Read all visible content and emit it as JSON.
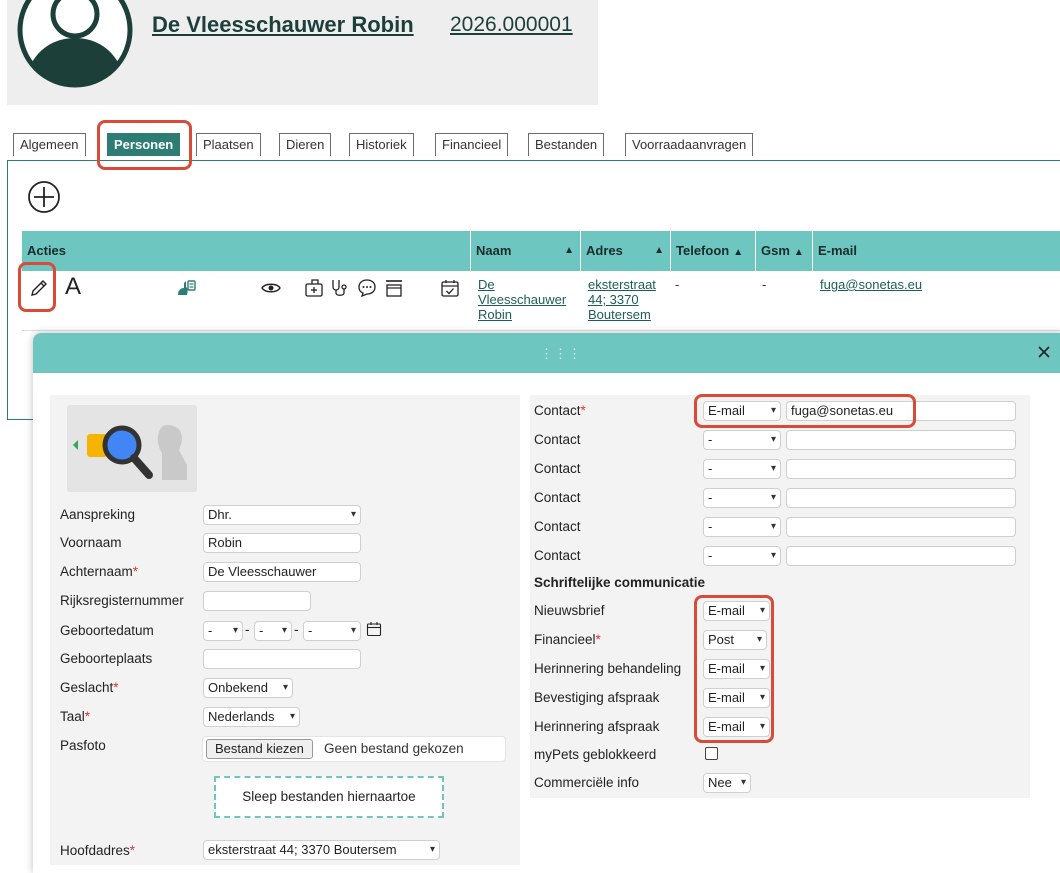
{
  "header": {
    "person_name": "De Vleesschauwer Robin",
    "record_number": "2026.000001"
  },
  "tabs": [
    {
      "label": "Algemeen"
    },
    {
      "label": "Personen",
      "active": true
    },
    {
      "label": "Plaatsen"
    },
    {
      "label": "Dieren"
    },
    {
      "label": "Historiek"
    },
    {
      "label": "Financieel"
    },
    {
      "label": "Bestanden"
    },
    {
      "label": "Voorraadaanvragen"
    }
  ],
  "table": {
    "columns": [
      "Acties",
      "Naam",
      "Adres",
      "Telefoon",
      "Gsm",
      "E-mail"
    ],
    "row": {
      "name": "De Vleesschauwer Robin",
      "name_lines": [
        "De",
        "Vleesschauwer",
        "Robin"
      ],
      "address_lines": [
        "eksterstraat",
        "44; 3370",
        "Boutersem"
      ],
      "phone": "-",
      "gsm": "-",
      "email": "fuga@sonetas.eu",
      "action_letter": "A"
    },
    "action_icons": [
      "edit-pencil-icon",
      "letter-a-icon",
      "pet-owner-icon",
      "view-eye-icon",
      "medical-kit-icon",
      "stethoscope-icon",
      "chat-bubble-icon",
      "scale-icon",
      "calendar-check-icon"
    ]
  },
  "form_left": {
    "fields": [
      {
        "label": "Aanspreking",
        "value": "Dhr.",
        "type": "select",
        "required": false
      },
      {
        "label": "Voornaam",
        "value": "Robin",
        "type": "text",
        "required": false
      },
      {
        "label": "Achternaam",
        "value": "De Vleesschauwer",
        "type": "text",
        "required": true
      },
      {
        "label": "Rijksregisternummer",
        "value": "",
        "type": "text",
        "required": false
      },
      {
        "label": "Geboortedatum",
        "value": "",
        "type": "date",
        "required": false
      },
      {
        "label": "Geboorteplaats",
        "value": "",
        "type": "text",
        "required": false
      },
      {
        "label": "Geslacht",
        "value": "Onbekend",
        "type": "select",
        "required": true
      },
      {
        "label": "Taal",
        "value": "Nederlands",
        "type": "select",
        "required": true
      },
      {
        "label": "Pasfoto",
        "value": "",
        "type": "file",
        "required": false
      },
      {
        "label": "Hoofdadres",
        "value": "eksterstraat 44; 3370 Boutersem",
        "type": "select",
        "required": true
      }
    ],
    "date_parts": [
      "-",
      "-",
      "-"
    ],
    "date_separator": "-",
    "file_button": "Bestand kiezen",
    "file_status": "Geen bestand gekozen",
    "dropzone": "Sleep bestanden hiernaartoe"
  },
  "form_right": {
    "contacts": [
      {
        "label": "Contact",
        "type": "E-mail",
        "value": "fuga@sonetas.eu",
        "required": true
      },
      {
        "label": "Contact",
        "type": "-",
        "value": "",
        "required": false
      },
      {
        "label": "Contact",
        "type": "-",
        "value": "",
        "required": false
      },
      {
        "label": "Contact",
        "type": "-",
        "value": "",
        "required": false
      },
      {
        "label": "Contact",
        "type": "-",
        "value": "",
        "required": false
      },
      {
        "label": "Contact",
        "type": "-",
        "value": "",
        "required": false
      }
    ],
    "section_title": "Schriftelijke communicatie",
    "communication": [
      {
        "label": "Nieuwsbrief",
        "value": "E-mail",
        "required": false
      },
      {
        "label": "Financieel",
        "value": "Post",
        "required": true
      },
      {
        "label": "Herinnering behandeling",
        "value": "E-mail",
        "required": false
      },
      {
        "label": "Bevestiging afspraak",
        "value": "E-mail",
        "required": false
      },
      {
        "label": "Herinnering afspraak",
        "value": "E-mail",
        "required": false
      }
    ],
    "mypets_label": "myPets geblokkeerd",
    "mypets_checked": false,
    "commercial_label": "Commerciële info",
    "commercial_value": "Nee"
  },
  "colors": {
    "accent": "#2e7d74",
    "header_teal": "#6ec6c1",
    "highlight": "#d94a38",
    "dark_green": "#1c3f3a"
  }
}
